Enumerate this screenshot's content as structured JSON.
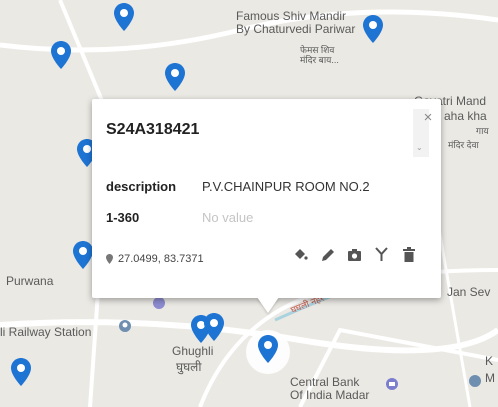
{
  "popup": {
    "title": "S24A318421",
    "close_glyph": "×",
    "fields": [
      {
        "label": "description",
        "value": "P.V.CHAINPUR ROOM NO.2"
      },
      {
        "label": "1-360",
        "value": "No value"
      }
    ],
    "coordinates": "27.0499, 83.7371",
    "tools": [
      "paint-bucket-icon",
      "pencil-icon",
      "camera-icon",
      "fork-icon",
      "trash-icon"
    ]
  },
  "map": {
    "labels": {
      "temple_en": "Famous Shiv Mandir\nBy Chaturvedi Pariwar",
      "temple_hi": "फेमस शिव\nमंदिर बाय...",
      "gayatri": "Gayatri Mand",
      "gayatri_2": "aha kha",
      "gayatri_hi_1": "गाय",
      "gayatri_hi_2": "मंदिर देवा",
      "purwana": "Purwana",
      "railway": "li Railway Station",
      "jansev": "Jan Sev",
      "ghughli": "Ghughli",
      "ghughli_hi": "घुघली",
      "bank": "Central Bank\nOf India Madar",
      "road": "घघली नहर",
      "right_edge_1": "K",
      "right_edge_2": "M"
    }
  },
  "colors": {
    "pin": "#1e74d3",
    "map_bg": "#ebe9e4",
    "road": "#ffffff",
    "water": "#aad3df"
  }
}
